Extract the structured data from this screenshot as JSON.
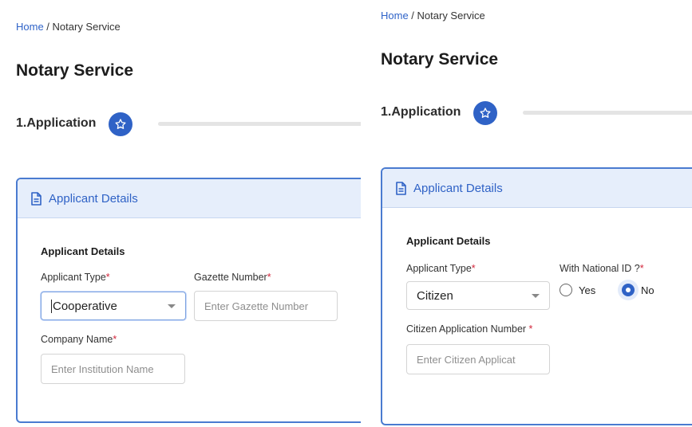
{
  "left": {
    "breadcrumb": {
      "home": "Home",
      "separator": " / ",
      "current": "Notary Service"
    },
    "page_title": "Notary Service",
    "step_label": "1.Application",
    "card": {
      "header_title": "Applicant Details",
      "section_title": "Applicant Details",
      "applicant_type_label": "Applicant Type",
      "applicant_type_value": "Cooperative",
      "gazette_label": "Gazette Number",
      "gazette_placeholder": "Enter Gazette Number",
      "company_label": "Company Name",
      "company_placeholder": "Enter Institution Name"
    }
  },
  "right": {
    "breadcrumb": {
      "home": "Home",
      "separator": " / ",
      "current": "Notary Service"
    },
    "page_title": "Notary Service",
    "step_label": "1.Application",
    "card": {
      "header_title": "Applicant Details",
      "section_title": "Applicant Details",
      "applicant_type_label": "Applicant Type",
      "applicant_type_value": "Citizen",
      "national_id_label": "With National ID ?",
      "national_id_options": [
        {
          "label": "Yes",
          "checked": false
        },
        {
          "label": "No",
          "checked": true
        }
      ],
      "citizen_app_label": "Citizen Application Number ",
      "citizen_app_placeholder": "Enter Citizen Applicat"
    }
  },
  "required_marker": "*",
  "icons": {
    "step": "star-icon",
    "header": "document-icon",
    "select": "caret-down-icon"
  },
  "colors": {
    "primary": "#2f62c6",
    "link": "#2f63c8",
    "required": "#d2263b",
    "card_header_bg": "#e6eefb"
  }
}
